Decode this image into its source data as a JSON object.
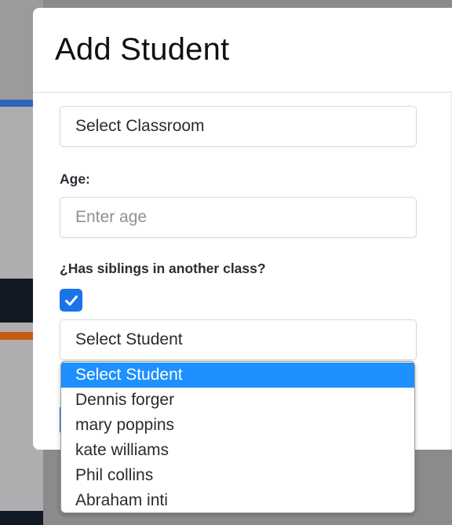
{
  "modal": {
    "title": "Add Student"
  },
  "form": {
    "classroom_select_value": "Select Classroom",
    "age_label": "Age:",
    "age_placeholder": "Enter age",
    "siblings_label": "¿Has siblings in another class?",
    "siblings_checked": true,
    "student_select_value": "Select Student"
  },
  "student_dropdown": {
    "options": [
      {
        "label": "Select Student",
        "selected": true
      },
      {
        "label": "Dennis forger",
        "selected": false
      },
      {
        "label": "mary poppins",
        "selected": false
      },
      {
        "label": "kate williams",
        "selected": false
      },
      {
        "label": "Phil collins",
        "selected": false
      },
      {
        "label": "Abraham inti",
        "selected": false
      }
    ]
  },
  "colors": {
    "accent": "#1a73e8",
    "option_highlight": "#1e90ff",
    "overlay": "#8b8b8d"
  },
  "icons": {
    "checkbox": "checkmark-icon"
  }
}
